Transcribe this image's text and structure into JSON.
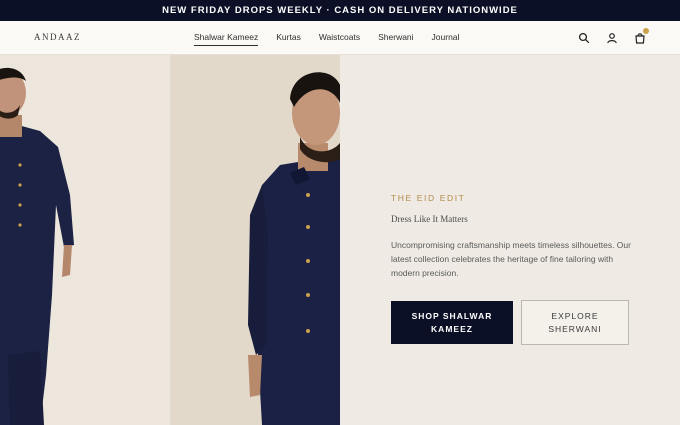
{
  "announcement": {
    "text": "NEW FRIDAY DROPS WEEKLY · CASH ON DELIVERY NATIONWIDE"
  },
  "header": {
    "logo": "ANDAAZ",
    "nav": [
      {
        "label": "Shalwar Kameez",
        "active": true
      },
      {
        "label": "Kurtas",
        "active": false
      },
      {
        "label": "Waistcoats",
        "active": false
      },
      {
        "label": "Sherwani",
        "active": false
      },
      {
        "label": "Journal",
        "active": false
      }
    ],
    "icons": [
      "search-icon",
      "account-icon",
      "cart-icon"
    ],
    "cart_has_items": true
  },
  "hero": {
    "eyebrow": "THE EID EDIT",
    "tagline": "Dress Like It Matters",
    "description": "Uncompromising craftsmanship meets timeless silhouettes. Our latest collection celebrates the heritage of fine tailoring with modern precision.",
    "primary_cta": "SHOP SHALWAR KAMEEZ",
    "secondary_cta": "EXPLORE SHERWANI"
  },
  "colors": {
    "navy": "#0c1026",
    "gold_accent": "#b28b4b",
    "background": "#efebe4"
  }
}
